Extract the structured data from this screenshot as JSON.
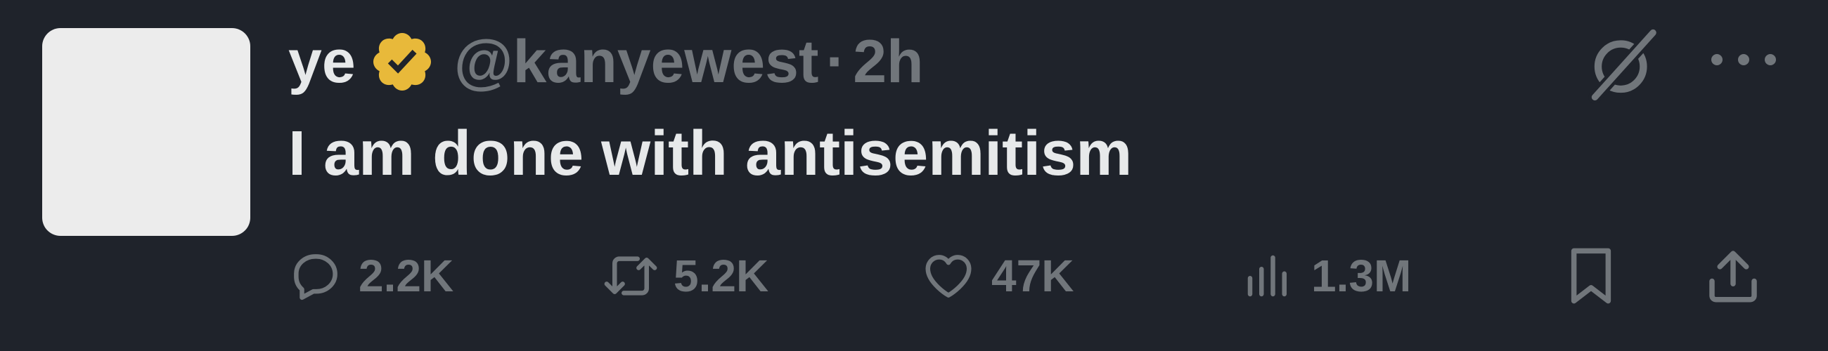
{
  "tweet": {
    "author_name": "ye",
    "verified_icon": "verified-badge-gold-icon",
    "handle": "@kanyewest",
    "separator": "·",
    "time": "2h",
    "text": "I am done with antisemitism"
  },
  "header_actions": {
    "grok_icon": "grok-icon",
    "more_icon": "more-icon"
  },
  "stats": {
    "replies": "2.2K",
    "reposts": "5.2K",
    "likes": "47K",
    "views": "1.3M"
  },
  "colors": {
    "background": "#1f232b",
    "primary_text": "#e7e9ea",
    "secondary_text": "#71767b",
    "badge_gold": "#e8b93a"
  }
}
